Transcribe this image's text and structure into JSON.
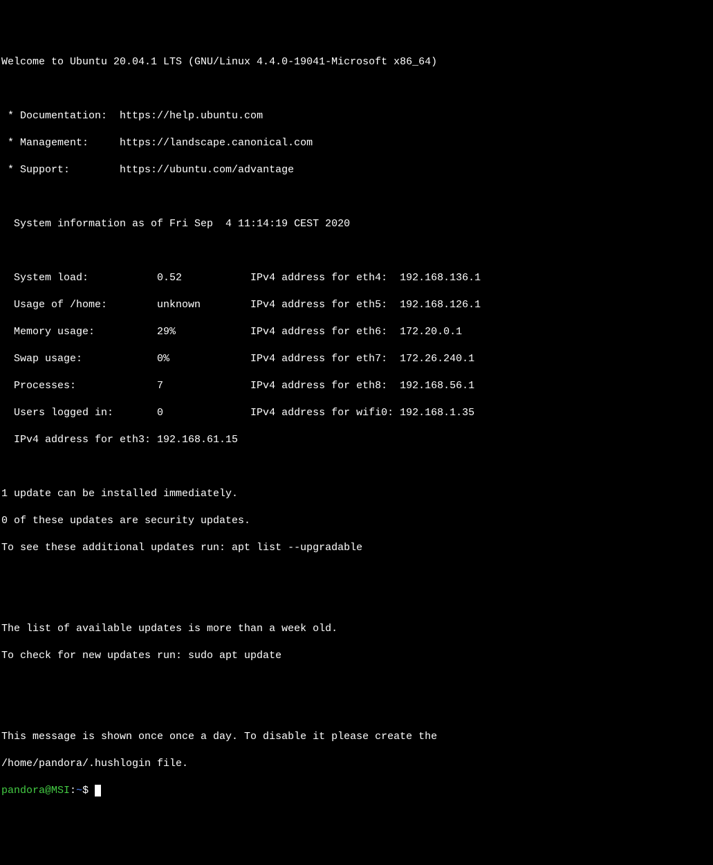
{
  "welcome": "Welcome to Ubuntu 20.04.1 LTS (GNU/Linux 4.4.0-19041-Microsoft x86_64)",
  "links": {
    "documentation": {
      "label": " * Documentation:  ",
      "url": "https://help.ubuntu.com"
    },
    "management": {
      "label": " * Management:     ",
      "url": "https://landscape.canonical.com"
    },
    "support": {
      "label": " * Support:        ",
      "url": "https://ubuntu.com/advantage"
    }
  },
  "sysinfo_header": "  System information as of Fri Sep  4 11:14:19 CEST 2020",
  "sysinfo": {
    "line1": "  System load:           0.52           IPv4 address for eth4:  192.168.136.1",
    "line2": "  Usage of /home:        unknown        IPv4 address for eth5:  192.168.126.1",
    "line3": "  Memory usage:          29%            IPv4 address for eth6:  172.20.0.1",
    "line4": "  Swap usage:            0%             IPv4 address for eth7:  172.26.240.1",
    "line5": "  Processes:             7              IPv4 address for eth8:  192.168.56.1",
    "line6": "  Users logged in:       0              IPv4 address for wifi0: 192.168.1.35",
    "line7": "  IPv4 address for eth3: 192.168.61.15"
  },
  "updates": {
    "line1": "1 update can be installed immediately.",
    "line2": "0 of these updates are security updates.",
    "line3": "To see these additional updates run: apt list --upgradable"
  },
  "updates_age": {
    "line1": "The list of available updates is more than a week old.",
    "line2": "To check for new updates run: sudo apt update"
  },
  "hushlogin": {
    "line1": "This message is shown once once a day. To disable it please create the",
    "line2": "/home/pandora/.hushlogin file."
  },
  "prompt": {
    "user": "pandora",
    "at": "@",
    "host": "MSI",
    "colon": ":",
    "path": "~",
    "dollar": "$"
  }
}
